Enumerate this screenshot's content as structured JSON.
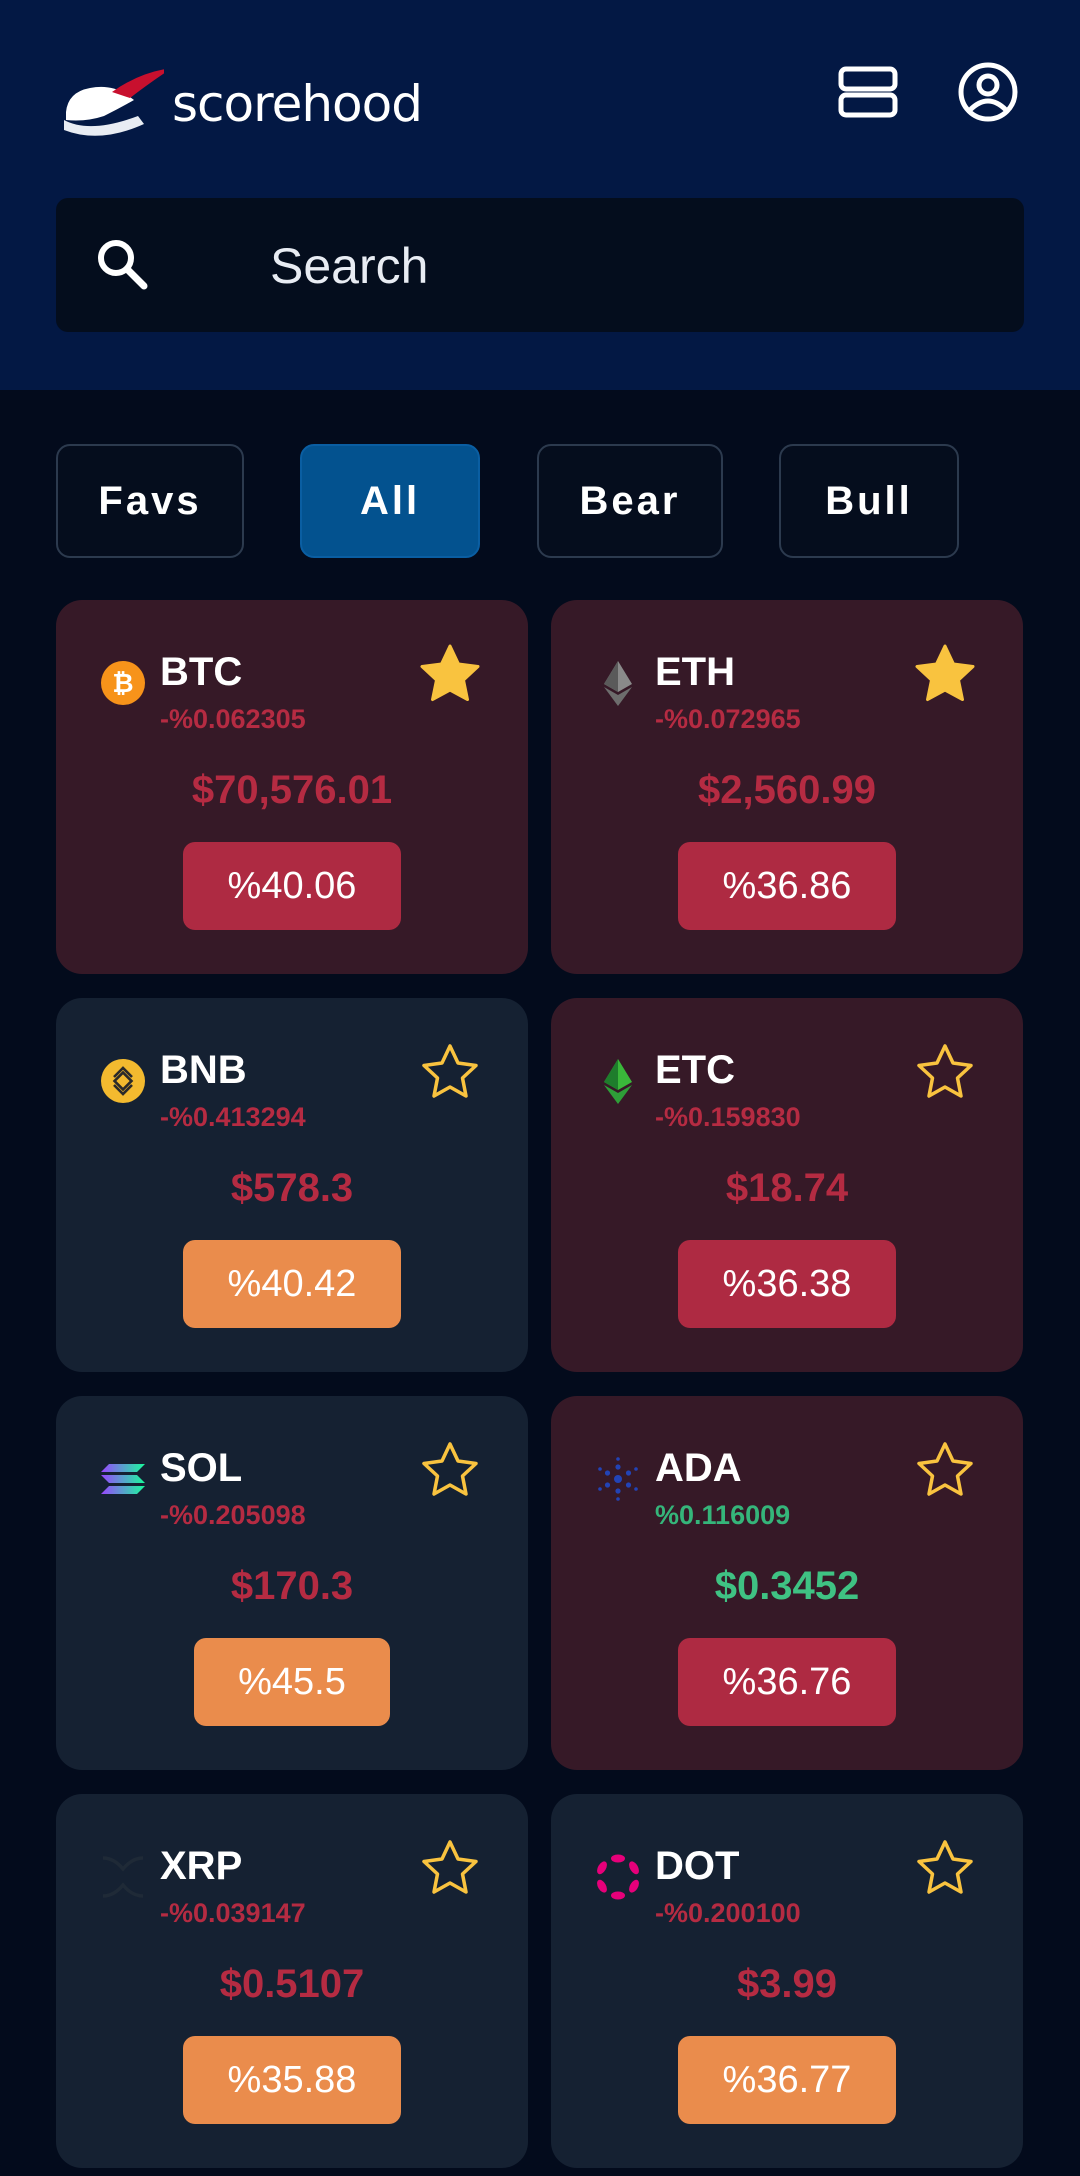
{
  "app": {
    "name": "scorehood"
  },
  "search": {
    "placeholder": "Search"
  },
  "tabs": [
    {
      "label": "Favs",
      "active": false
    },
    {
      "label": "All",
      "active": true
    },
    {
      "label": "Bear",
      "active": false
    },
    {
      "label": "Bull",
      "active": false
    }
  ],
  "cards": [
    {
      "symbol": "BTC",
      "change": "-%0.062305",
      "price": "$70,576.01",
      "badge": "%40.06",
      "favorite": true,
      "icon": "bitcoin-icon"
    },
    {
      "symbol": "ETH",
      "change": "-%0.072965",
      "price": "$2,560.99",
      "badge": "%36.86",
      "favorite": true,
      "icon": "ethereum-icon"
    },
    {
      "symbol": "BNB",
      "change": "-%0.413294",
      "price": "$578.3",
      "badge": "%40.42",
      "favorite": false,
      "icon": "bnb-icon"
    },
    {
      "symbol": "ETC",
      "change": "-%0.159830",
      "price": "$18.74",
      "badge": "%36.38",
      "favorite": false,
      "icon": "ethereum-classic-icon"
    },
    {
      "symbol": "SOL",
      "change": "-%0.205098",
      "price": "$170.3",
      "badge": "%45.5",
      "favorite": false,
      "icon": "solana-icon"
    },
    {
      "symbol": "ADA",
      "change": "%0.116009",
      "price": "$0.3452",
      "badge": "%36.76",
      "favorite": false,
      "icon": "cardano-icon"
    },
    {
      "symbol": "XRP",
      "change": "-%0.039147",
      "price": "$0.5107",
      "badge": "%35.88",
      "favorite": false,
      "icon": "xrp-icon"
    },
    {
      "symbol": "DOT",
      "change": "-%0.200100",
      "price": "$3.99",
      "badge": "%36.77",
      "favorite": false,
      "icon": "polkadot-icon"
    }
  ],
  "colors": {
    "header_bg": "#031844",
    "page_bg": "#030b1c",
    "card_neutral": "#152132",
    "card_red": "#361927",
    "negative": "#b52b42",
    "positive": "#3fc283",
    "badge_red": "#ae2a42",
    "badge_orange": "#ea8c4c",
    "star": "#f9c33f",
    "tab_active": "#03528f"
  }
}
